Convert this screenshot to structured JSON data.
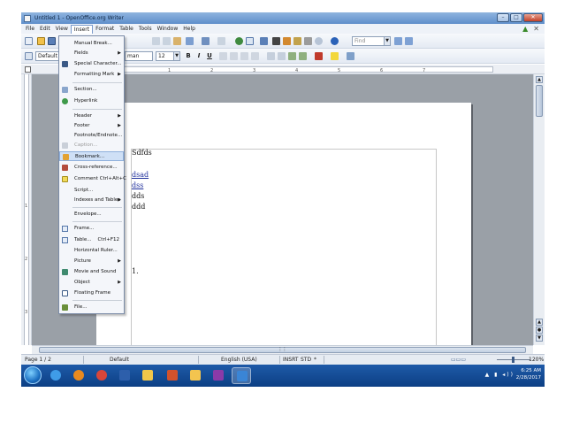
{
  "window": {
    "title": "Untitled 1 - OpenOffice.org Writer",
    "buttons": {
      "minimize": "–",
      "maximize": "□",
      "close": "✕"
    }
  },
  "menubar": {
    "items": [
      "File",
      "Edit",
      "View",
      "Insert",
      "Format",
      "Table",
      "Tools",
      "Window",
      "Help"
    ]
  },
  "toolbar": {
    "find_placeholder": "Find",
    "paragraph_style": "Default",
    "font_name": "Times New Roman",
    "font_name_visible": "man",
    "font_size": "12",
    "bold": "B",
    "italic": "I",
    "underline": "U"
  },
  "ruler": {
    "ticks": [
      "1",
      "2",
      "3",
      "4",
      "5",
      "6",
      "7"
    ]
  },
  "vruler": {
    "marks": [
      "1",
      "2",
      "3"
    ]
  },
  "insert_menu": {
    "items": [
      {
        "label": "Manual Break...",
        "submenu": false,
        "icon": "none"
      },
      {
        "label": "Fields",
        "submenu": true,
        "icon": "none"
      },
      {
        "label": "Special Character...",
        "submenu": false,
        "icon": "omega-icon"
      },
      {
        "label": "Formatting Mark",
        "submenu": true,
        "icon": "none"
      },
      {
        "label": "Section...",
        "submenu": false,
        "icon": "section-icon"
      },
      {
        "label": "Hyperlink",
        "submenu": false,
        "icon": "globe-icon"
      },
      {
        "label": "Header",
        "submenu": true,
        "icon": "none"
      },
      {
        "label": "Footer",
        "submenu": true,
        "icon": "none"
      },
      {
        "label": "Footnote/Endnote...",
        "submenu": false,
        "icon": "none"
      },
      {
        "label": "Caption...",
        "submenu": false,
        "icon": "caption-icon",
        "disabled": true
      },
      {
        "label": "Bookmark...",
        "submenu": false,
        "icon": "bookmark-icon",
        "highlighted": true
      },
      {
        "label": "Cross-reference...",
        "submenu": false,
        "icon": "cross-reference-icon"
      },
      {
        "label": "Comment",
        "shortcut": "Ctrl+Alt+C",
        "submenu": false,
        "icon": "comment-icon"
      },
      {
        "label": "Script...",
        "submenu": false,
        "icon": "none"
      },
      {
        "label": "Indexes and Tables",
        "submenu": true,
        "icon": "none"
      },
      {
        "label": "Envelope...",
        "submenu": false,
        "icon": "none"
      },
      {
        "label": "Frame...",
        "submenu": false,
        "icon": "frame-icon"
      },
      {
        "label": "Table...",
        "shortcut": "Ctrl+F12",
        "submenu": false,
        "icon": "table-icon"
      },
      {
        "label": "Horizontal Ruler...",
        "submenu": false,
        "icon": "none"
      },
      {
        "label": "Picture",
        "submenu": true,
        "icon": "none"
      },
      {
        "label": "Movie and Sound",
        "submenu": false,
        "icon": "movie-icon"
      },
      {
        "label": "Object",
        "submenu": true,
        "icon": "none"
      },
      {
        "label": "Floating Frame",
        "submenu": false,
        "icon": "floating-frame-icon"
      },
      {
        "label": "File...",
        "submenu": false,
        "icon": "file-icon"
      }
    ]
  },
  "document": {
    "lines": [
      "Sdfds",
      "dsad",
      "dss",
      "dds",
      "ddd"
    ],
    "list_number": "1."
  },
  "statusbar": {
    "page": "Page 1 / 2",
    "style": "Default",
    "language": "English (USA)",
    "insert_mode": "INSRT",
    "selection_mode": "STD",
    "zoom": "120%"
  },
  "taskbar": {
    "time": "6:25 AM",
    "date": "2/28/2017"
  },
  "colors": {
    "titlebar": "#5f8fcb",
    "taskbar": "#0c3f84",
    "page_bg": "#9aa0a7",
    "menu_highlight": "#cfe0f6"
  }
}
